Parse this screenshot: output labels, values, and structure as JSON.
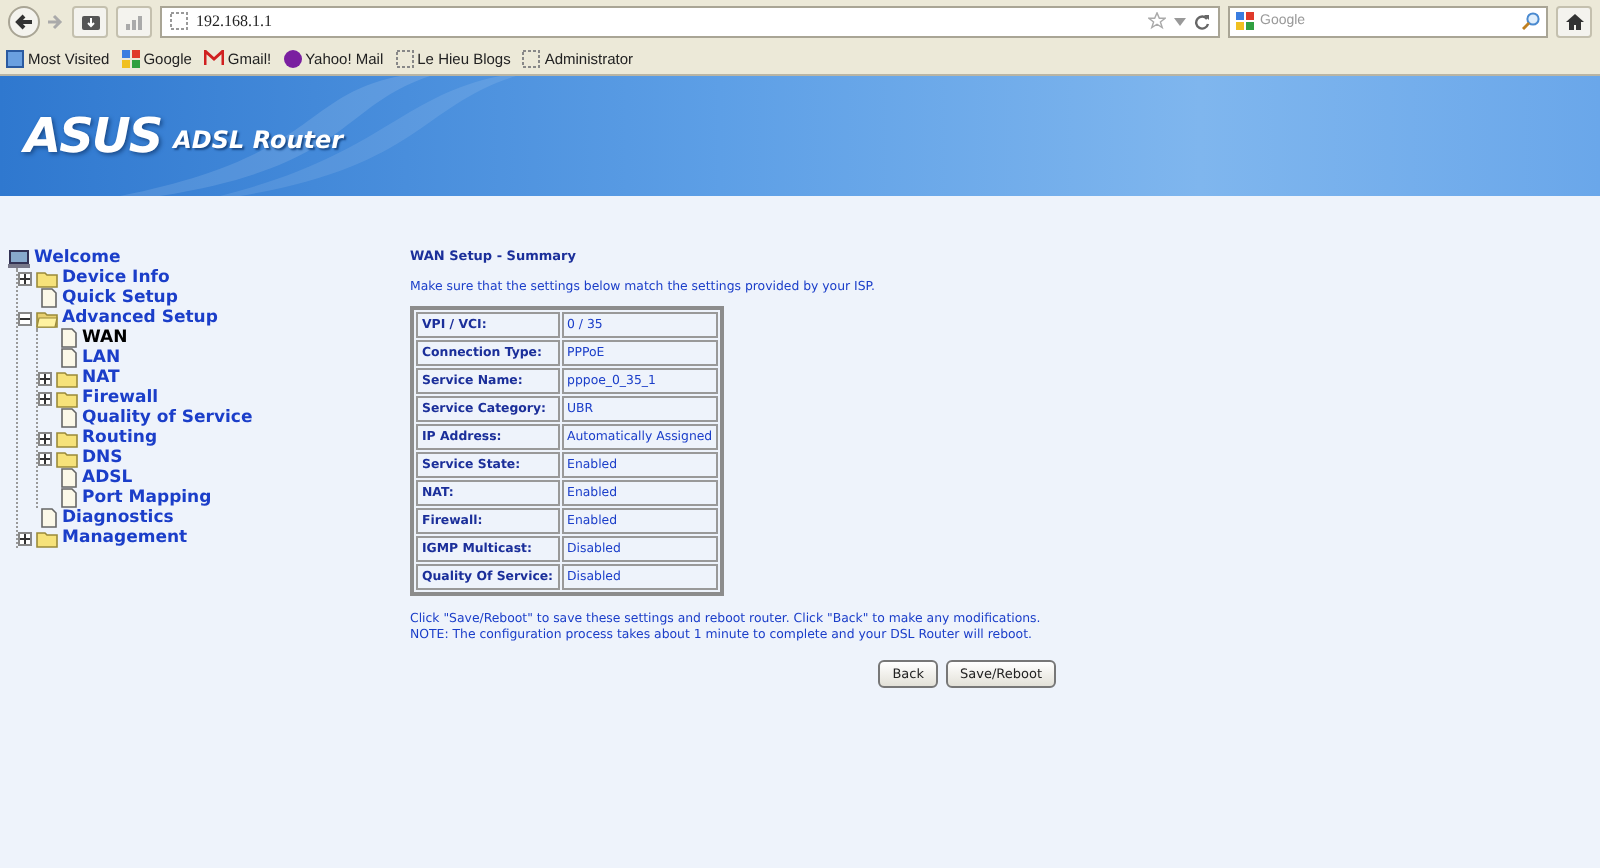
{
  "browser": {
    "url": "192.168.1.1",
    "search_placeholder": "Google",
    "bookmarks": [
      {
        "label": "Most Visited",
        "kind": "folder"
      },
      {
        "label": "Google",
        "kind": "google"
      },
      {
        "label": "Gmail!",
        "kind": "gmail"
      },
      {
        "label": "Yahoo! Mail",
        "kind": "yahoo"
      },
      {
        "label": "Le Hieu Blogs",
        "kind": "page"
      },
      {
        "label": "Administrator",
        "kind": "page"
      }
    ]
  },
  "banner": {
    "logo": "ASUS",
    "subtitle": "ADSL Router"
  },
  "tree": {
    "label": "Welcome",
    "children": [
      {
        "label": "Device Info",
        "kind": "folder",
        "expanded": false,
        "selected": false
      },
      {
        "label": "Quick Setup",
        "kind": "page",
        "selected": false
      },
      {
        "label": "Advanced Setup",
        "kind": "folder",
        "expanded": true,
        "selected": false,
        "children": [
          {
            "label": "WAN",
            "kind": "page",
            "selected": true
          },
          {
            "label": "LAN",
            "kind": "page",
            "selected": false
          },
          {
            "label": "NAT",
            "kind": "folder",
            "expanded": false,
            "selected": false
          },
          {
            "label": "Firewall",
            "kind": "folder",
            "expanded": false,
            "selected": false
          },
          {
            "label": "Quality of Service",
            "kind": "page",
            "selected": false
          },
          {
            "label": "Routing",
            "kind": "folder",
            "expanded": false,
            "selected": false
          },
          {
            "label": "DNS",
            "kind": "folder",
            "expanded": false,
            "selected": false
          },
          {
            "label": "ADSL",
            "kind": "page",
            "selected": false
          },
          {
            "label": "Port Mapping",
            "kind": "page",
            "selected": false
          }
        ]
      },
      {
        "label": "Diagnostics",
        "kind": "page",
        "selected": false
      },
      {
        "label": "Management",
        "kind": "folder",
        "expanded": false,
        "selected": false
      }
    ]
  },
  "content": {
    "title": "WAN Setup - Summary",
    "intro": "Make sure that the settings below match the settings provided by your ISP.",
    "rows": [
      {
        "label": "VPI / VCI:",
        "value": "0 / 35"
      },
      {
        "label": "Connection Type:",
        "value": "PPPoE"
      },
      {
        "label": "Service Name:",
        "value": "pppoe_0_35_1"
      },
      {
        "label": "Service Category:",
        "value": "UBR"
      },
      {
        "label": "IP Address:",
        "value": "Automatically Assigned"
      },
      {
        "label": "Service State:",
        "value": "Enabled"
      },
      {
        "label": "NAT:",
        "value": "Enabled"
      },
      {
        "label": "Firewall:",
        "value": "Enabled"
      },
      {
        "label": "IGMP Multicast:",
        "value": "Disabled"
      },
      {
        "label": "Quality Of Service:",
        "value": "Disabled"
      }
    ],
    "notes": [
      "Click \"Save/Reboot\" to save these settings and reboot router. Click \"Back\" to make any modifications.",
      "NOTE: The configuration process takes about 1 minute to complete and your DSL Router will reboot."
    ],
    "buttons": [
      "Back",
      "Save/Reboot"
    ]
  }
}
